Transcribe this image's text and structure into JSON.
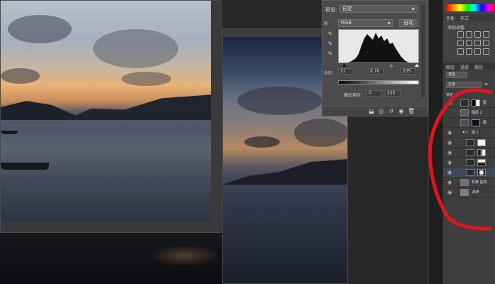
{
  "levels": {
    "preset_label": "预设:",
    "preset_value": "自定",
    "channel_value": "RGB",
    "auto_label": "自动",
    "input_black": "21",
    "input_gamma": "0.70",
    "input_white": "255",
    "output_label": "输出色阶:",
    "output_black": "0",
    "output_white": "255",
    "side_label": "色阶"
  },
  "adjustments": {
    "tab_swatches": "色板",
    "tab_styles": "样式",
    "add_label": "添加调整"
  },
  "layers": {
    "tab_layers": "图层",
    "tab_channels": "通道",
    "tab_paths": "路径",
    "filter_value": "类型",
    "blend_value": "正常",
    "opacity_label": "不",
    "lock_label": "锁定:",
    "rows": [
      {
        "name": "图",
        "kind": "adjust"
      },
      {
        "name": "图层 2",
        "kind": "pixel"
      },
      {
        "name": "图",
        "kind": "pixel-mask"
      },
      {
        "name": "组 1",
        "kind": "group"
      },
      {
        "name": "",
        "kind": "adjust-mask"
      },
      {
        "name": "",
        "kind": "adjust-mask"
      },
      {
        "name": "",
        "kind": "adjust-mask"
      },
      {
        "name": "",
        "kind": "adjust-mask-sel"
      },
      {
        "name": "背景 副本",
        "kind": "pixel"
      },
      {
        "name": "背景",
        "kind": "pixel"
      }
    ]
  },
  "colors": {
    "annotation_red": "#e0141e",
    "panel_bg": "#434343",
    "dialog_bg": "#4b4b4b"
  }
}
